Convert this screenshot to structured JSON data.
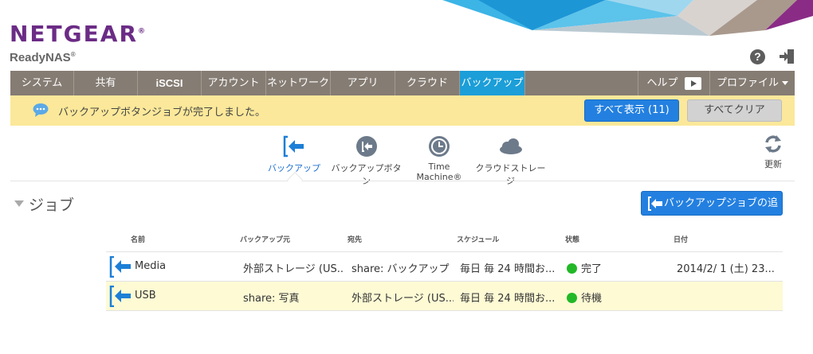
{
  "header": {
    "brand": "NETGEAR",
    "brand_mark": "®",
    "product": "ReadyNAS",
    "product_mark": "®",
    "help_glyph": "?",
    "colors": {
      "brand": "#6b2c85",
      "nav_bg": "#857c73",
      "nav_active": "#1c9ed8",
      "accent_blue": "#2380e0",
      "notify_bg": "#fbe89a",
      "status_ok": "#22b827"
    }
  },
  "nav": {
    "items": [
      "システム",
      "共有",
      "iSCSI",
      "アカウント",
      "ネットワーク",
      "アプリ",
      "クラウド",
      "バックアップ"
    ],
    "active": "バックアップ",
    "help": "ヘルプ",
    "profile": "プロファイル"
  },
  "notification": {
    "message": "バックアップボタンジョブが完了しました。",
    "show_all": "すべて表示 (11)",
    "clear_all": "すべてクリア"
  },
  "tabs": [
    {
      "label": "バックアップ",
      "icon": "backup-icon",
      "active": true
    },
    {
      "label": "バックアップボタン",
      "icon": "backup-button-icon",
      "active": false
    },
    {
      "label": "Time Machine®",
      "icon": "time-machine-icon",
      "active": false
    },
    {
      "label": "クラウドストレージ",
      "icon": "cloud-storage-icon",
      "active": false
    }
  ],
  "refresh": {
    "label": "更新",
    "icon": "refresh-icon"
  },
  "jobs": {
    "section_title": "ジョブ",
    "add_button": "バックアップジョブの追加",
    "columns": [
      "名前",
      "バックアップ元",
      "宛先",
      "スケジュール",
      "状態",
      "日付"
    ],
    "rows": [
      {
        "name": "Media",
        "source": "外部ストレージ (US...",
        "destination": "share: バックアップ",
        "schedule": "毎日 毎 24 時間お...",
        "status": "完了",
        "date": "2014/2/ 1 (土) 23...",
        "selected": false
      },
      {
        "name": "USB",
        "source": "share: 写真",
        "destination": "外部ストレージ (US...",
        "schedule": "毎日 毎 24 時間お...",
        "status": "待機",
        "date": "",
        "selected": true
      }
    ]
  }
}
